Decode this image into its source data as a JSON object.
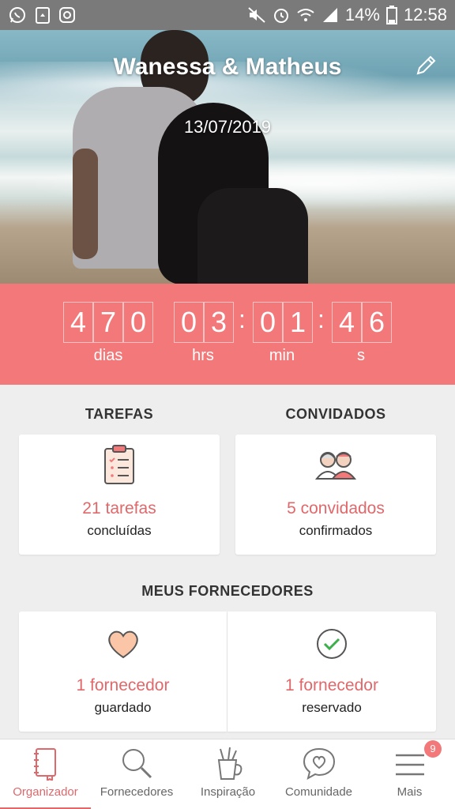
{
  "status_bar": {
    "battery": "14%",
    "time": "12:58",
    "left_icons": [
      "whatsapp-icon",
      "recycle-icon",
      "instagram-icon"
    ],
    "right_icons": [
      "mute-icon",
      "alarm-icon",
      "wifi-icon",
      "signal-icon",
      "battery-icon"
    ]
  },
  "hero": {
    "couple_names": "Wanessa & Matheus",
    "wedding_date": "13/07/2019",
    "edit_icon": "pencil-icon"
  },
  "countdown": {
    "days": [
      "4",
      "7",
      "0"
    ],
    "hours": [
      "0",
      "3"
    ],
    "minutes": [
      "0",
      "1"
    ],
    "seconds": [
      "4",
      "6"
    ],
    "labels": {
      "days": "dias",
      "hours": "hrs",
      "minutes": "min",
      "seconds": "s"
    }
  },
  "summary": {
    "tasks_title": "TAREFAS",
    "tasks_count": "21 tarefas",
    "tasks_sub": "concluídas",
    "guests_title": "CONVIDADOS",
    "guests_count": "5 convidados",
    "guests_sub": "confirmados"
  },
  "vendors": {
    "title": "MEUS FORNECEDORES",
    "saved_count": "1 fornecedor",
    "saved_sub": "guardado",
    "booked_count": "1 fornecedor",
    "booked_sub": "reservado"
  },
  "bottom_nav": {
    "items": [
      {
        "label": "Organizador",
        "icon": "notebook-icon",
        "active": true
      },
      {
        "label": "Fornecedores",
        "icon": "search-icon",
        "active": false
      },
      {
        "label": "Inspiração",
        "icon": "pencil-cup-icon",
        "active": false
      },
      {
        "label": "Comunidade",
        "icon": "chat-heart-icon",
        "active": false
      },
      {
        "label": "Mais",
        "icon": "menu-icon",
        "active": false
      }
    ],
    "more_badge": "9"
  },
  "colors": {
    "accent": "#f37879",
    "accent_text": "#e0686b",
    "status_bar": "#7a7a7a"
  }
}
